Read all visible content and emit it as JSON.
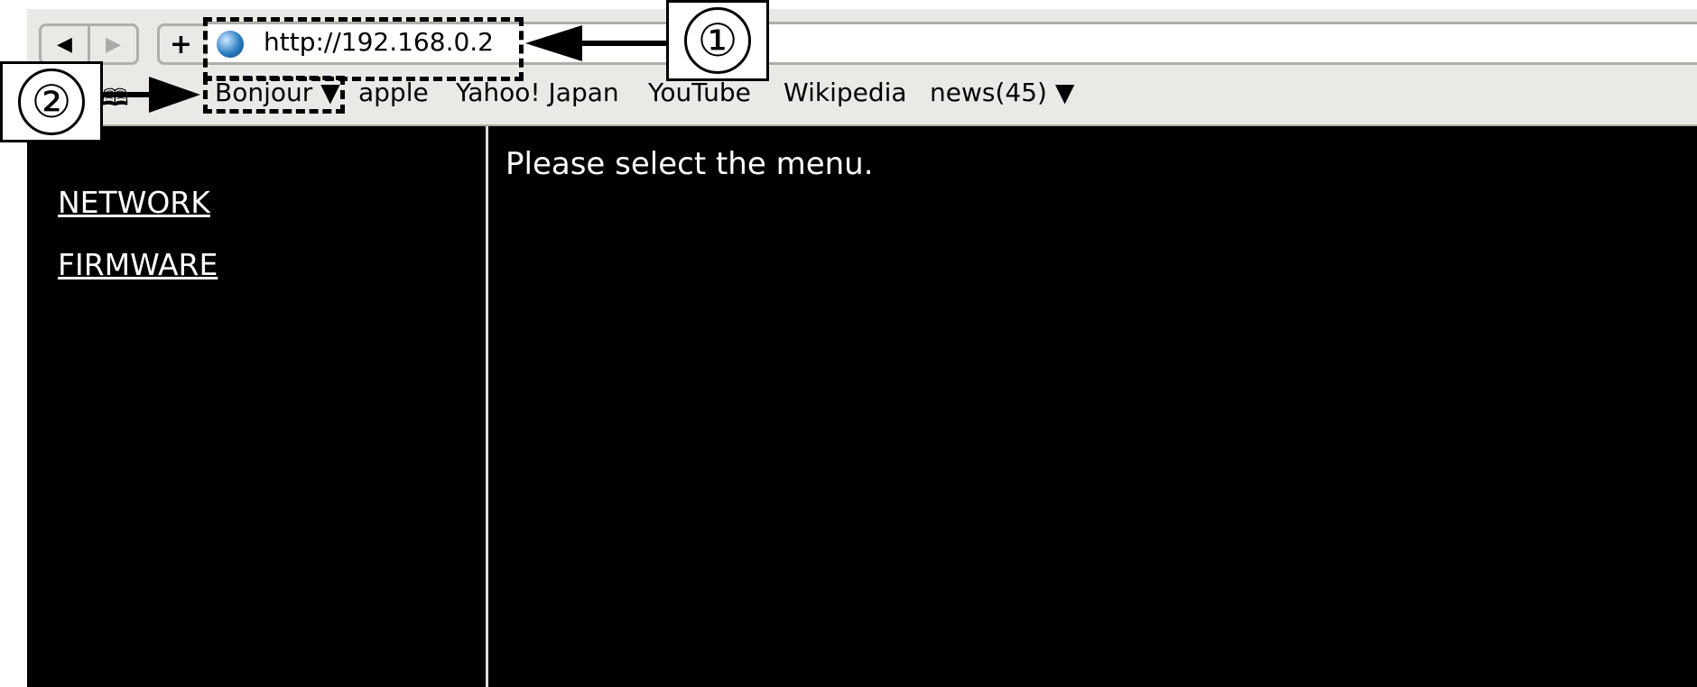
{
  "browser": {
    "back_icon": "triangle-left",
    "forward_icon": "triangle-right",
    "new_tab_label": "+",
    "url": "http://192.168.0.2",
    "bookmarks": [
      {
        "label": "Bonjour ▼"
      },
      {
        "label": "apple"
      },
      {
        "label": "Yahoo! Japan"
      },
      {
        "label": "YouTube"
      },
      {
        "label": "Wikipedia"
      },
      {
        "label": "news(45) ▼"
      }
    ]
  },
  "sidebar": {
    "items": [
      {
        "label": "NETWORK"
      },
      {
        "label": "FIRMWARE"
      }
    ]
  },
  "main": {
    "message": "Please select the menu."
  },
  "callouts": [
    {
      "label": "①"
    },
    {
      "label": "②"
    }
  ]
}
